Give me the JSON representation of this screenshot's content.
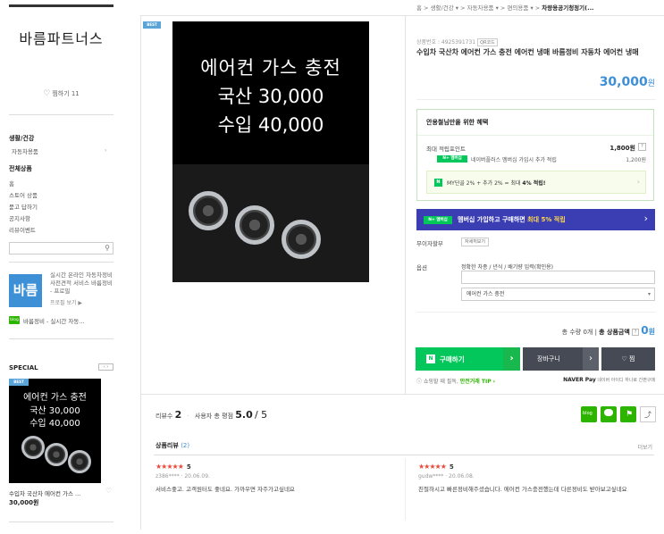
{
  "sidebar": {
    "shop_name": "바름파트너스",
    "favorite_label": "찜하기 11",
    "category_head": "생활/건강",
    "category_sub": "자동차용품",
    "all_products_head": "전체상품",
    "links": [
      "홈",
      "스토어 상품",
      "묻고 답하기",
      "공지사항",
      "리뷰이벤트"
    ],
    "biz_desc": "실시간 온라인 자동차정비 사전견적 서비스 바름정비 - 프로필",
    "profile_link": "프로필 보기 ▶",
    "logo_text": "바름",
    "blog_icon": "blog",
    "blog_text": "바름정비 - 실시간 자동...",
    "special_head": "SPECIAL",
    "pager": "‹ ›",
    "special_badge": "BEST",
    "special_img_lines": [
      "에어컨 가스 충전",
      "국산 30,000",
      "수입 40,000"
    ],
    "special_name": "수입차 국산차 에어컨 가스 ...",
    "special_price": "30,000원"
  },
  "breadcrumb": {
    "items": [
      "홈",
      "생활/건강",
      "자동차용품",
      "편의용품"
    ],
    "current": "차량용공기청정기(..."
  },
  "product": {
    "badge": "BEST",
    "image_lines": [
      "에어컨 가스 충전",
      "국산 30,000",
      "수입 40,000"
    ],
    "code": "상품번호 : 4925391731",
    "qr_label": "QR코드",
    "title": "수입차 국산차 에어컨 가스 충전 에어컨 냉매 바름정비 자동차 에어컨 냉매",
    "price": "30,000",
    "price_unit": "원"
  },
  "benefit": {
    "head": "안용철님만을 위한 혜택",
    "point_label": "최대 적립포인트",
    "point_value": "1,800원",
    "np_tag": "N+ 멤버십",
    "np_text": "네이버플러스 멤버십 가입시 추가 적립",
    "np_value": "1,200원",
    "my_icon": "N",
    "my_text_prefix": "MY단골 2% + 추가 2% = 최대",
    "my_text_strong": "4% 적립!"
  },
  "membership_banner": {
    "tag": "N+ 멤버십",
    "text": "멤버십 가입하고 구매하면",
    "highlight": "최대 5% 적립"
  },
  "installment": {
    "label": "무이자할부",
    "button": "자세히보기"
  },
  "options": {
    "label": "옵션",
    "field_label": "정확한 차종 / 년식 / 배기량 입력(확인용)",
    "input_value": "",
    "select_value": "에어컨 가스 충전"
  },
  "totals": {
    "qty_text": "총 수량 0개",
    "amount_label": "총 상품금액",
    "amount_value": "0",
    "amount_unit": "원"
  },
  "actions": {
    "buy": "구매하기",
    "cart": "장바구니",
    "wish": "♡ 찜"
  },
  "info": {
    "shopping_text": "쇼핑할 때 필독,",
    "safe_trade": "안전거래 TIP ›",
    "npay_brand": "NAVER Pay",
    "npay_text": "네이버 아이디 하나로 간편구매"
  },
  "reviews": {
    "count_label": "리뷰수",
    "count": "2",
    "rating_label": "사용자 총 평점",
    "rating": "5.0",
    "rating_max": "/ 5",
    "section_title": "상품리뷰",
    "section_count": "(2)",
    "more": "더보기",
    "items": [
      {
        "stars": "★★★★★",
        "score": "5",
        "meta": "z386**** · 20.06.09.",
        "body": "서비스좋고. 고객원터도 좋네요. 가까우면 자주가고싶네요"
      },
      {
        "stars": "★★★★★",
        "score": "5",
        "meta": "gudw**** · 20.06.08.",
        "body": "친절하시고 빠른정비해주셨습니다. 에어컨 가스충전했는데 다른정비도 받아보고싶네요"
      }
    ]
  },
  "sns": [
    "blog",
    "talk",
    "story",
    "share"
  ]
}
